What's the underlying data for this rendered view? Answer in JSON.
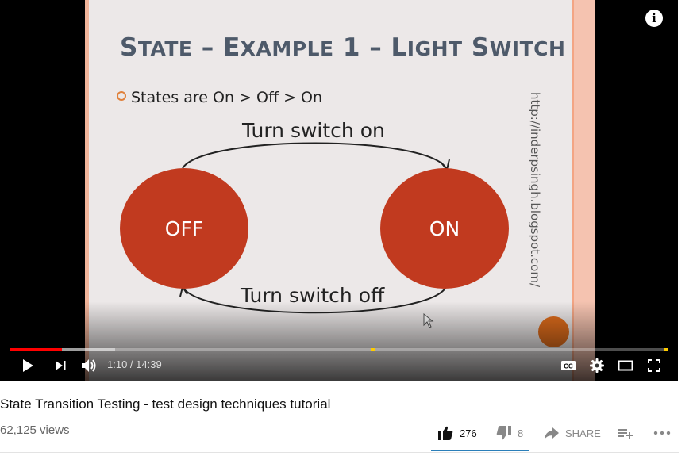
{
  "player": {
    "slide": {
      "title_caps": [
        "S",
        "TATE",
        " – E",
        "XAMPLE",
        " 1 – L",
        "IGHT",
        " S",
        "WITCH"
      ],
      "bullet": "States are On > Off > On",
      "state_off": "OFF",
      "state_on": "ON",
      "transition_top": "Turn switch on",
      "transition_bottom": "Turn switch off",
      "url": "http://inderpsingh.blogspot.com/"
    },
    "time": "1:10 / 14:39",
    "progress": {
      "played_fraction": 0.08,
      "buffered_fraction": 0.16
    },
    "colors": {
      "played": "#ff0000",
      "ad_marker": "#ffcc00",
      "slide_circle": "#c13a1f"
    },
    "icons": [
      "info-icon",
      "play-icon",
      "next-icon",
      "volume-icon",
      "captions-icon",
      "settings-icon",
      "theater-icon",
      "fullscreen-icon"
    ]
  },
  "video": {
    "title": "State Transition Testing - test design techniques tutorial",
    "views": "62,125 views",
    "likes": "276",
    "dislikes": "8",
    "share_label": "SHARE"
  }
}
